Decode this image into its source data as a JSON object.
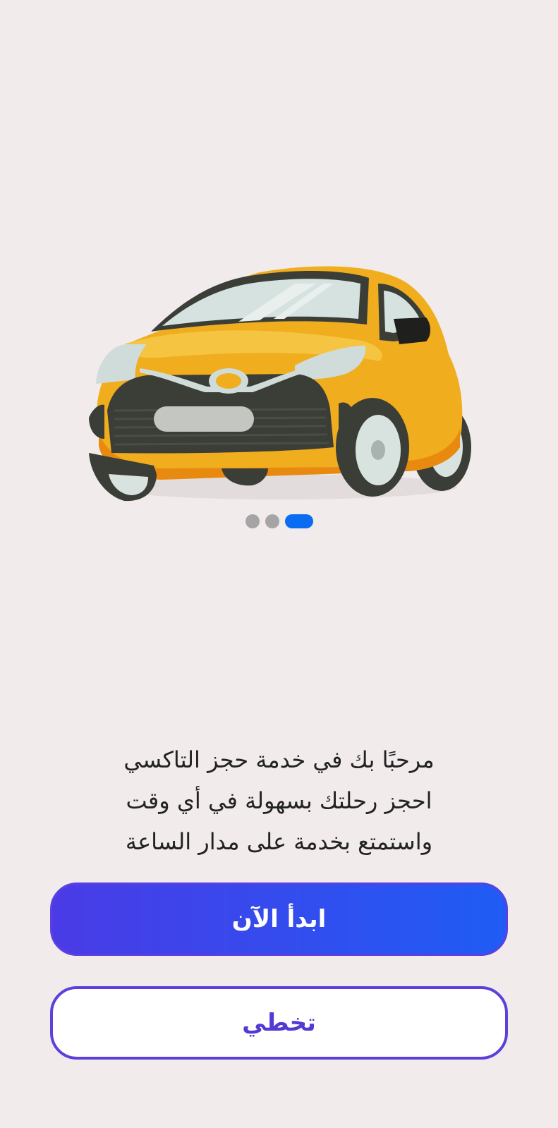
{
  "onboarding": {
    "illustration": "yellow-taxi-car-illustration",
    "pagination": {
      "total": 3,
      "active_index": 2,
      "active_color": "#0a6cf0",
      "inactive_color": "#a5a5a5"
    },
    "welcome_lines": [
      "مرحبًا بك في خدمة حجز التاكسي",
      "احجز رحلتك بسهولة في أي وقت",
      "واستمتع بخدمة على مدار الساعة"
    ],
    "start_button": {
      "label": "ابدأ الآن",
      "gradient_start": "#1f5cf5",
      "gradient_end": "#4a3be6"
    },
    "skip_button": {
      "label": "تخطي",
      "text_color": "#5539d4",
      "border_color": "#5b40dc"
    }
  }
}
